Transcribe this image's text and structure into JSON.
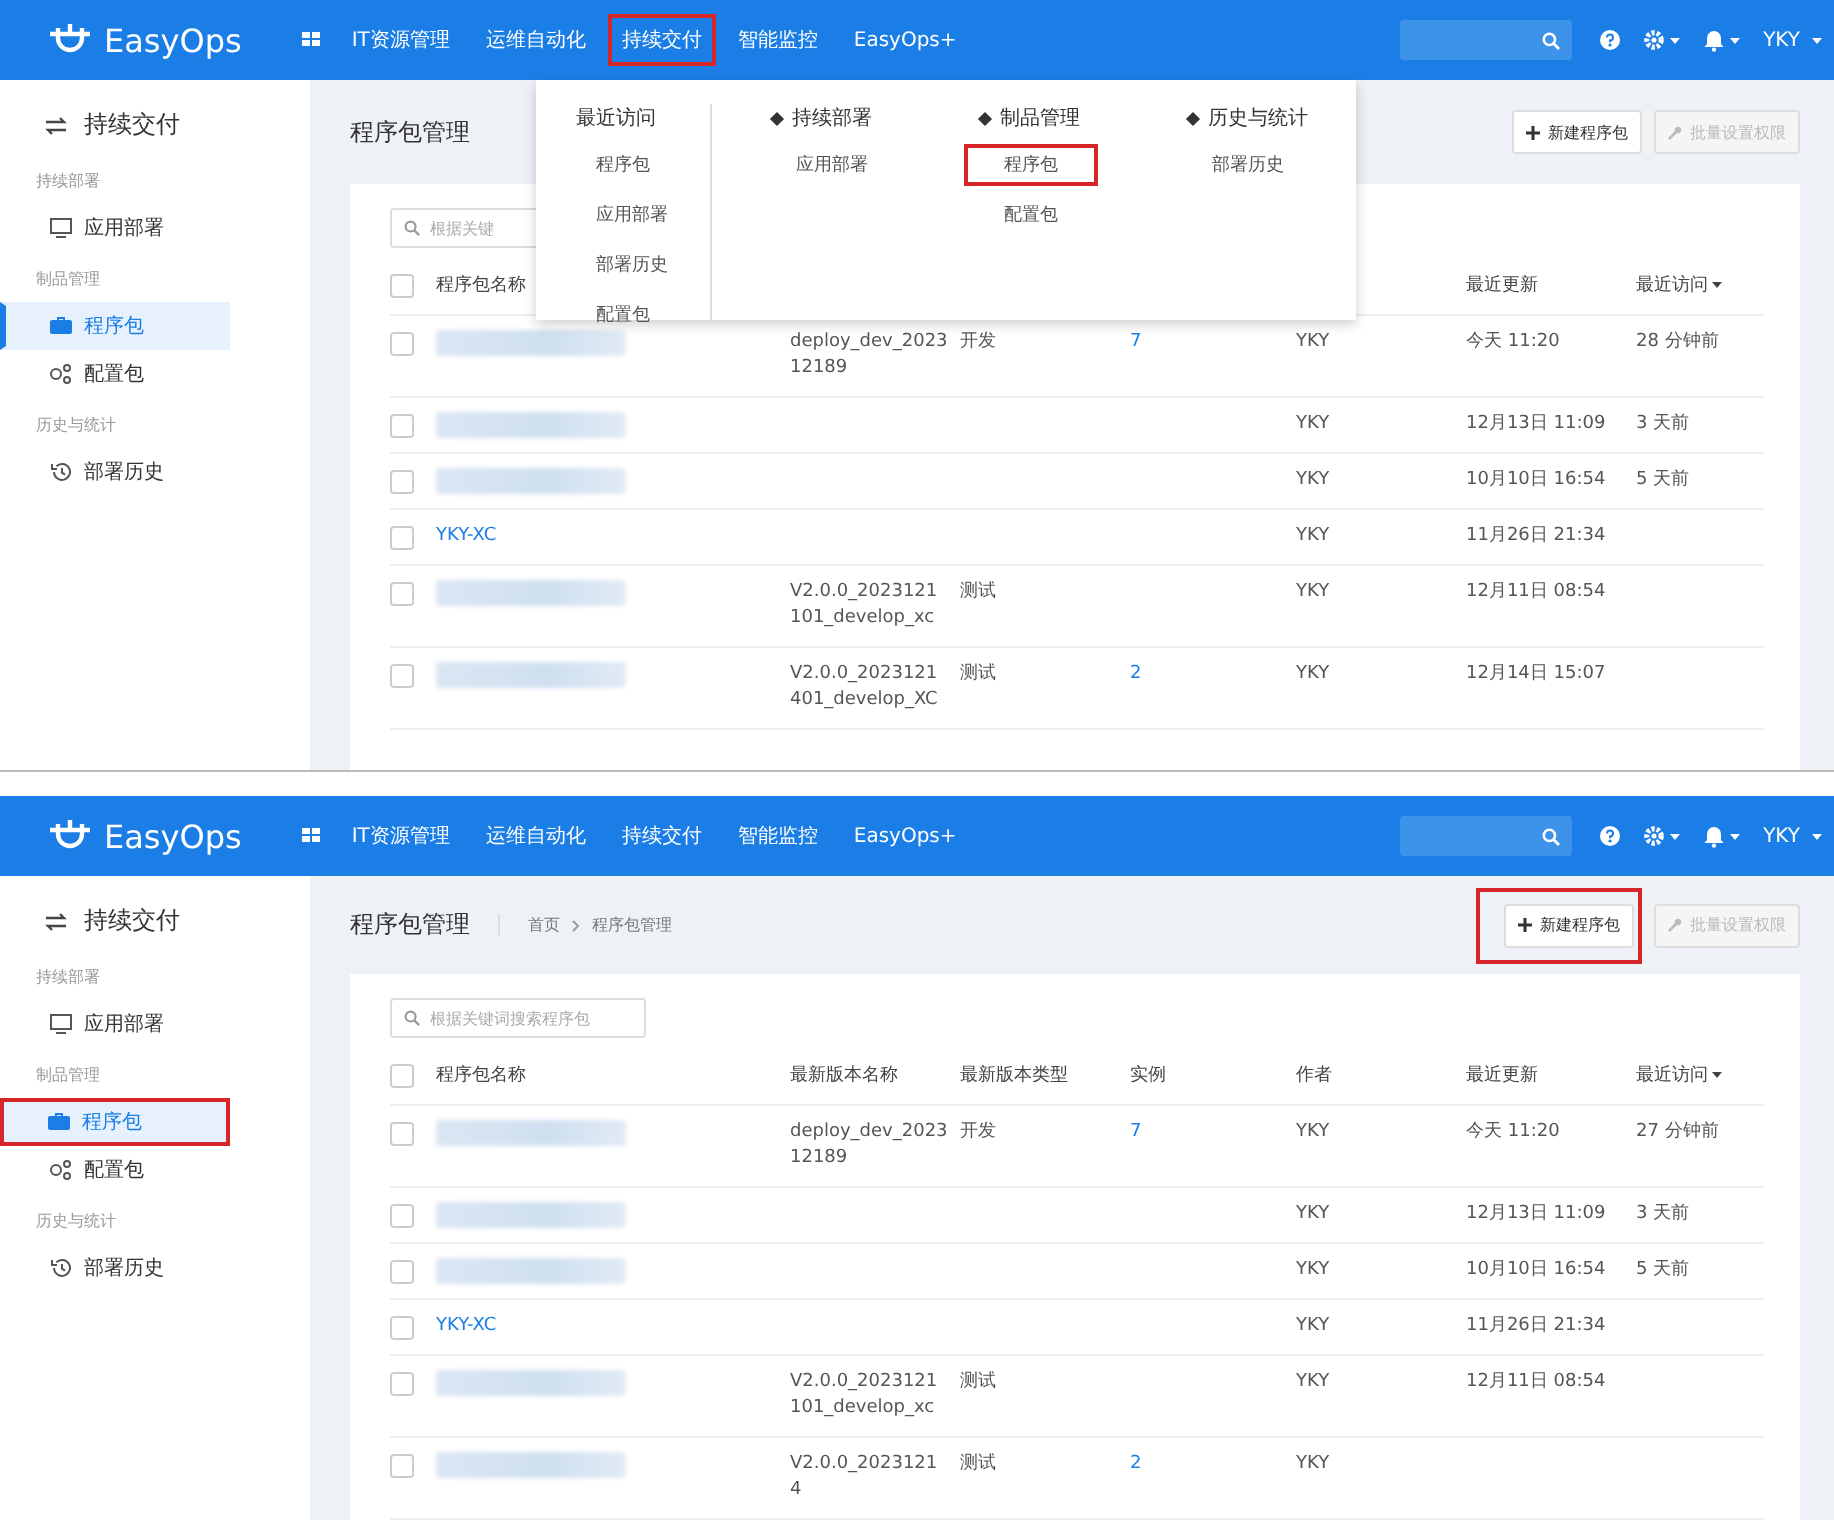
{
  "panels": [
    {
      "nav": {
        "logo": "EasyOps",
        "items": [
          {
            "label": "IT资源管理",
            "highlighted": false
          },
          {
            "label": "运维自动化",
            "highlighted": false
          },
          {
            "label": "持续交付",
            "highlighted": true
          },
          {
            "label": "智能监控",
            "highlighted": false
          },
          {
            "label": "EasyOps+",
            "highlighted": false
          }
        ],
        "user": "YKY"
      },
      "dropdown": {
        "groups": [
          {
            "kind": "recent",
            "title": "最近访问",
            "items": [
              {
                "label": "程序包",
                "highlighted": false
              },
              {
                "label": "应用部署",
                "highlighted": false
              },
              {
                "label": "部署历史",
                "highlighted": false
              },
              {
                "label": "配置包",
                "highlighted": false
              }
            ]
          },
          {
            "kind": "category",
            "title": "持续部署",
            "items": [
              {
                "label": "应用部署",
                "highlighted": false
              }
            ]
          },
          {
            "kind": "category",
            "title": "制品管理",
            "items": [
              {
                "label": "程序包",
                "highlighted": true
              },
              {
                "label": "配置包",
                "highlighted": false
              }
            ]
          },
          {
            "kind": "category",
            "title": "历史与统计",
            "items": [
              {
                "label": "部署历史",
                "highlighted": false
              }
            ]
          }
        ]
      },
      "sidebar": {
        "title": "持续交付",
        "sections": [
          {
            "label": "持续部署",
            "items": [
              {
                "label": "应用部署",
                "selected": false,
                "highlighted": false
              }
            ]
          },
          {
            "label": "制品管理",
            "items": [
              {
                "label": "程序包",
                "selected": true,
                "highlighted": false
              },
              {
                "label": "配置包",
                "selected": false,
                "highlighted": false
              }
            ]
          },
          {
            "label": "历史与统计",
            "items": [
              {
                "label": "部署历史",
                "selected": false,
                "highlighted": false
              }
            ]
          }
        ]
      },
      "page_title": "程序包管理",
      "buttons": [
        {
          "label": "新建程序包",
          "kind": "add",
          "disabled": false,
          "highlighted": false
        },
        {
          "label": "批量设置权限",
          "kind": "permission",
          "disabled": true,
          "highlighted": false
        }
      ],
      "search": {
        "placeholder": "根据关键"
      },
      "select_all": {
        "checked": false
      },
      "columns": [
        {
          "kind": "name",
          "label": "程序包名称"
        },
        {
          "kind": "updated",
          "label": "最近更新"
        },
        {
          "kind": "visited",
          "label": "最近访问",
          "sorted": true
        }
      ],
      "rows": [
        {
          "checked": false,
          "name": {
            "kind": "redacted"
          },
          "version": "deploy_dev_202312189",
          "type": "开发",
          "instances": "7",
          "author": "YKY",
          "updated": "今天 11:20",
          "visited": "28 分钟前"
        },
        {
          "checked": false,
          "name": {
            "kind": "redacted"
          },
          "author": "YKY",
          "updated": "12月13日 11:09",
          "visited": "3 天前"
        },
        {
          "checked": false,
          "name": {
            "kind": "redacted"
          },
          "author": "YKY",
          "updated": "10月10日 16:54",
          "visited": "5 天前"
        },
        {
          "checked": false,
          "name": {
            "kind": "link",
            "text": "YKY-XC"
          },
          "author": "YKY",
          "updated": "11月26日 21:34"
        },
        {
          "checked": false,
          "name": {
            "kind": "redacted"
          },
          "version": "V2.0.0_2023121101_develop_xc",
          "type": "测试",
          "author": "YKY",
          "updated": "12月11日 08:54"
        },
        {
          "checked": false,
          "name": {
            "kind": "redacted"
          },
          "version": "V2.0.0_2023121401_develop_XC",
          "type": "测试",
          "instances": "2",
          "author": "YKY",
          "updated": "12月14日 15:07"
        }
      ]
    },
    {
      "nav": {
        "logo": "EasyOps",
        "items": [
          {
            "label": "IT资源管理",
            "highlighted": false
          },
          {
            "label": "运维自动化",
            "highlighted": false
          },
          {
            "label": "持续交付",
            "highlighted": false
          },
          {
            "label": "智能监控",
            "highlighted": false
          },
          {
            "label": "EasyOps+",
            "highlighted": false
          }
        ],
        "user": "YKY"
      },
      "sidebar": {
        "title": "持续交付",
        "sections": [
          {
            "label": "持续部署",
            "items": [
              {
                "label": "应用部署",
                "selected": false,
                "highlighted": false
              }
            ]
          },
          {
            "label": "制品管理",
            "items": [
              {
                "label": "程序包",
                "selected": true,
                "highlighted": true
              },
              {
                "label": "配置包",
                "selected": false,
                "highlighted": false
              }
            ]
          },
          {
            "label": "历史与统计",
            "items": [
              {
                "label": "部署历史",
                "selected": false,
                "highlighted": false
              }
            ]
          }
        ]
      },
      "page_title": "程序包管理",
      "breadcrumb": [
        "首页",
        "程序包管理"
      ],
      "buttons": [
        {
          "label": "新建程序包",
          "kind": "add",
          "disabled": false,
          "highlighted": true
        },
        {
          "label": "批量设置权限",
          "kind": "permission",
          "disabled": true,
          "highlighted": false
        }
      ],
      "search": {
        "placeholder": "根据关键词搜索程序包"
      },
      "select_all": {
        "checked": false
      },
      "columns": [
        {
          "kind": "name",
          "label": "程序包名称"
        },
        {
          "kind": "version",
          "label": "最新版本名称"
        },
        {
          "kind": "type",
          "label": "最新版本类型"
        },
        {
          "kind": "instances",
          "label": "实例"
        },
        {
          "kind": "author",
          "label": "作者"
        },
        {
          "kind": "updated",
          "label": "最近更新"
        },
        {
          "kind": "visited",
          "label": "最近访问",
          "sorted": true
        }
      ],
      "rows": [
        {
          "checked": false,
          "name": {
            "kind": "redacted"
          },
          "version": "deploy_dev_202312189",
          "type": "开发",
          "instances": "7",
          "author": "YKY",
          "updated": "今天 11:20",
          "visited": "27 分钟前"
        },
        {
          "checked": false,
          "name": {
            "kind": "redacted"
          },
          "author": "YKY",
          "updated": "12月13日 11:09",
          "visited": "3 天前"
        },
        {
          "checked": false,
          "name": {
            "kind": "redacted"
          },
          "author": "YKY",
          "updated": "10月10日 16:54",
          "visited": "5 天前"
        },
        {
          "checked": false,
          "name": {
            "kind": "link",
            "text": "YKY-XC"
          },
          "author": "YKY",
          "updated": "11月26日 21:34"
        },
        {
          "checked": false,
          "name": {
            "kind": "redacted"
          },
          "version": "V2.0.0_2023121101_develop_xc",
          "type": "测试",
          "author": "YKY",
          "updated": "12月11日 08:54"
        },
        {
          "checked": false,
          "name": {
            "kind": "redacted"
          },
          "version": "V2.0.0_20231214",
          "type": "测试",
          "instances": "2",
          "author": "YKY"
        }
      ]
    }
  ]
}
